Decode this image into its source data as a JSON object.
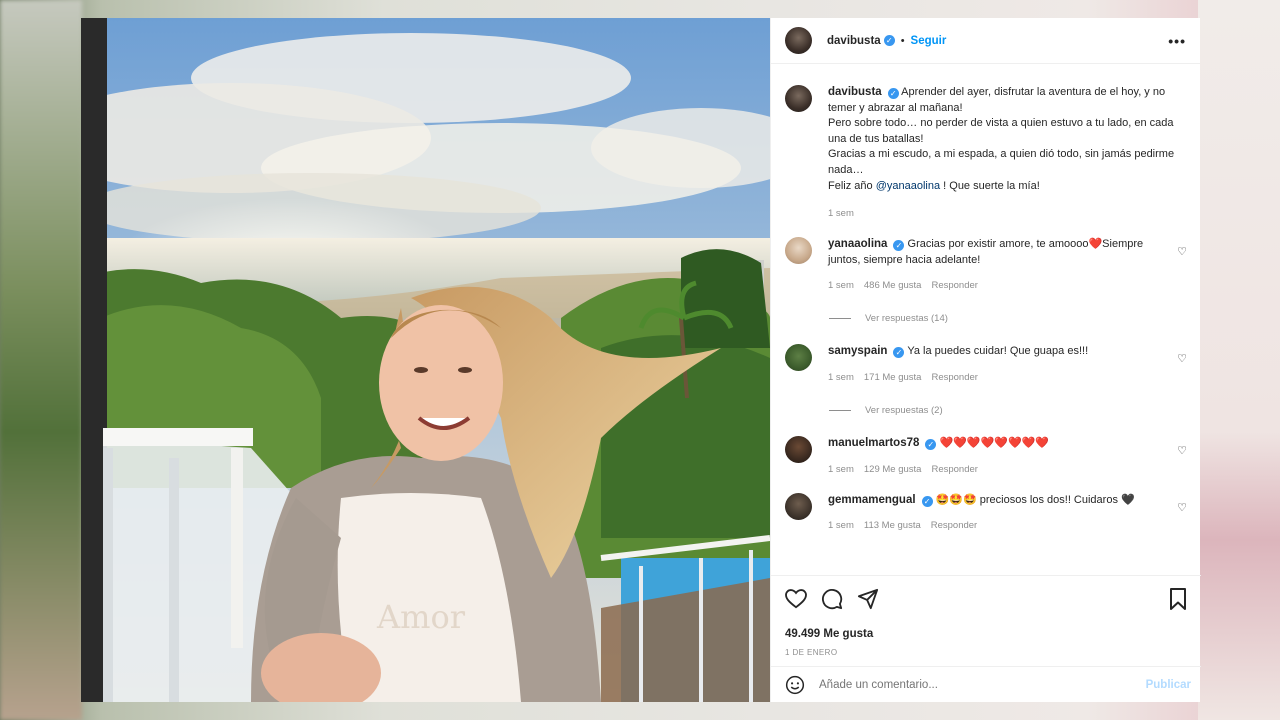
{
  "header": {
    "username": "davibusta",
    "verified_mark": "✓",
    "dot": "•",
    "follow_label": "Seguir",
    "more_label": "•••"
  },
  "caption": {
    "username": "davibusta",
    "lines": [
      "Aprender del ayer, disfrutar la aventura de el hoy, y no temer y abrazar al mañana!",
      "Pero sobre todo… no perder de vista a quien estuvo a tu lado, en cada una de tus batallas!",
      "Gracias a mi escudo, a mi espada, a quien dió todo, sin jamás pedirme nada…"
    ],
    "last_line_prefix": "Feliz año ",
    "mention": "@yanaaolina",
    "last_line_suffix": " ! Que suerte la mía!",
    "time": "1 sem"
  },
  "comments": [
    {
      "username": "yanaaolina",
      "text": "Gracias por existir amore, te amoooo❤️Siempre juntos, siempre hacia adelante!",
      "time": "1 sem",
      "likes": "486 Me gusta",
      "reply": "Responder",
      "replies": "Ver respuestas (14)"
    },
    {
      "username": "samyspain",
      "text": "Ya la puedes cuidar! Que guapa es!!!",
      "time": "1 sem",
      "likes": "171 Me gusta",
      "reply": "Responder",
      "replies": "Ver respuestas (2)"
    },
    {
      "username": "manuelmartos78",
      "text": "❤️❤️❤️❤️❤️❤️❤️❤️",
      "time": "1 sem",
      "likes": "129 Me gusta",
      "reply": "Responder"
    },
    {
      "username": "gemmamengual",
      "text": "🤩🤩🤩 preciosos los dos!! Cuidaros 🖤",
      "time": "1 sem",
      "likes": "113 Me gusta",
      "reply": "Responder"
    }
  ],
  "footer": {
    "likes": "49.499 Me gusta",
    "date": "1 DE ENERO",
    "comment_placeholder": "Añade un comentario...",
    "publish_label": "Publicar"
  },
  "photo": {
    "shirt_text": "Amor"
  },
  "colors": {
    "accent": "#0095f6",
    "verified": "#3897f0",
    "text": "#262626",
    "muted": "#8e8e8e",
    "heart": "#ed1c3b"
  }
}
